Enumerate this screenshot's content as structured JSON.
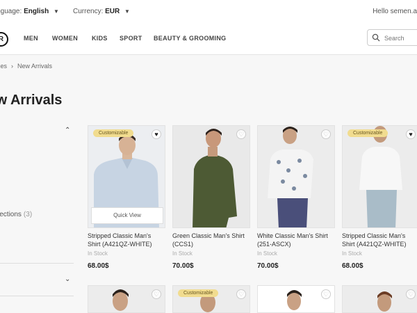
{
  "topbar": {
    "language_label": "Language:",
    "language_value": "English",
    "currency_label": "Currency:",
    "currency_value": "EUR",
    "greeting": "Hello semen.a"
  },
  "nav": {
    "items": [
      "MEN",
      "WOMEN",
      "KIDS",
      "SPORT",
      "BEAUTY & GROOMING"
    ],
    "search_placeholder": "Search"
  },
  "breadcrumb": {
    "parent": "Categories",
    "current": "New Arrivals"
  },
  "page_title": "New Arrivals",
  "sidebar": {
    "collection_label": "Collections",
    "collection_count": "(3)"
  },
  "products": [
    {
      "badge": "Customizable",
      "title": "Stripped Classic Man's Shirt (A421QZ-WHITE) Ap...",
      "stock": "In Stock",
      "price": "68.00$",
      "quick_view": "Quick View"
    },
    {
      "badge": "",
      "title": "Green Classic Man's Shirt (CCS1)",
      "stock": "In Stock",
      "price": "70.00$",
      "quick_view": ""
    },
    {
      "badge": "",
      "title": "White Classic Man's Shirt (251-ASCX)",
      "stock": "In Stock",
      "price": "70.00$",
      "quick_view": ""
    },
    {
      "badge": "Customizable",
      "title": "Stripped Classic Man's Shirt (A421QZ-WHITE) Ap...",
      "stock": "In Stock",
      "price": "68.00$",
      "quick_view": ""
    }
  ],
  "second_row": [
    {
      "badge": ""
    },
    {
      "badge": "Customizable"
    },
    {
      "badge": ""
    },
    {
      "badge": ""
    }
  ],
  "colors": {
    "badge_bg": "#f1dc8f",
    "accent_text": "#222222"
  }
}
